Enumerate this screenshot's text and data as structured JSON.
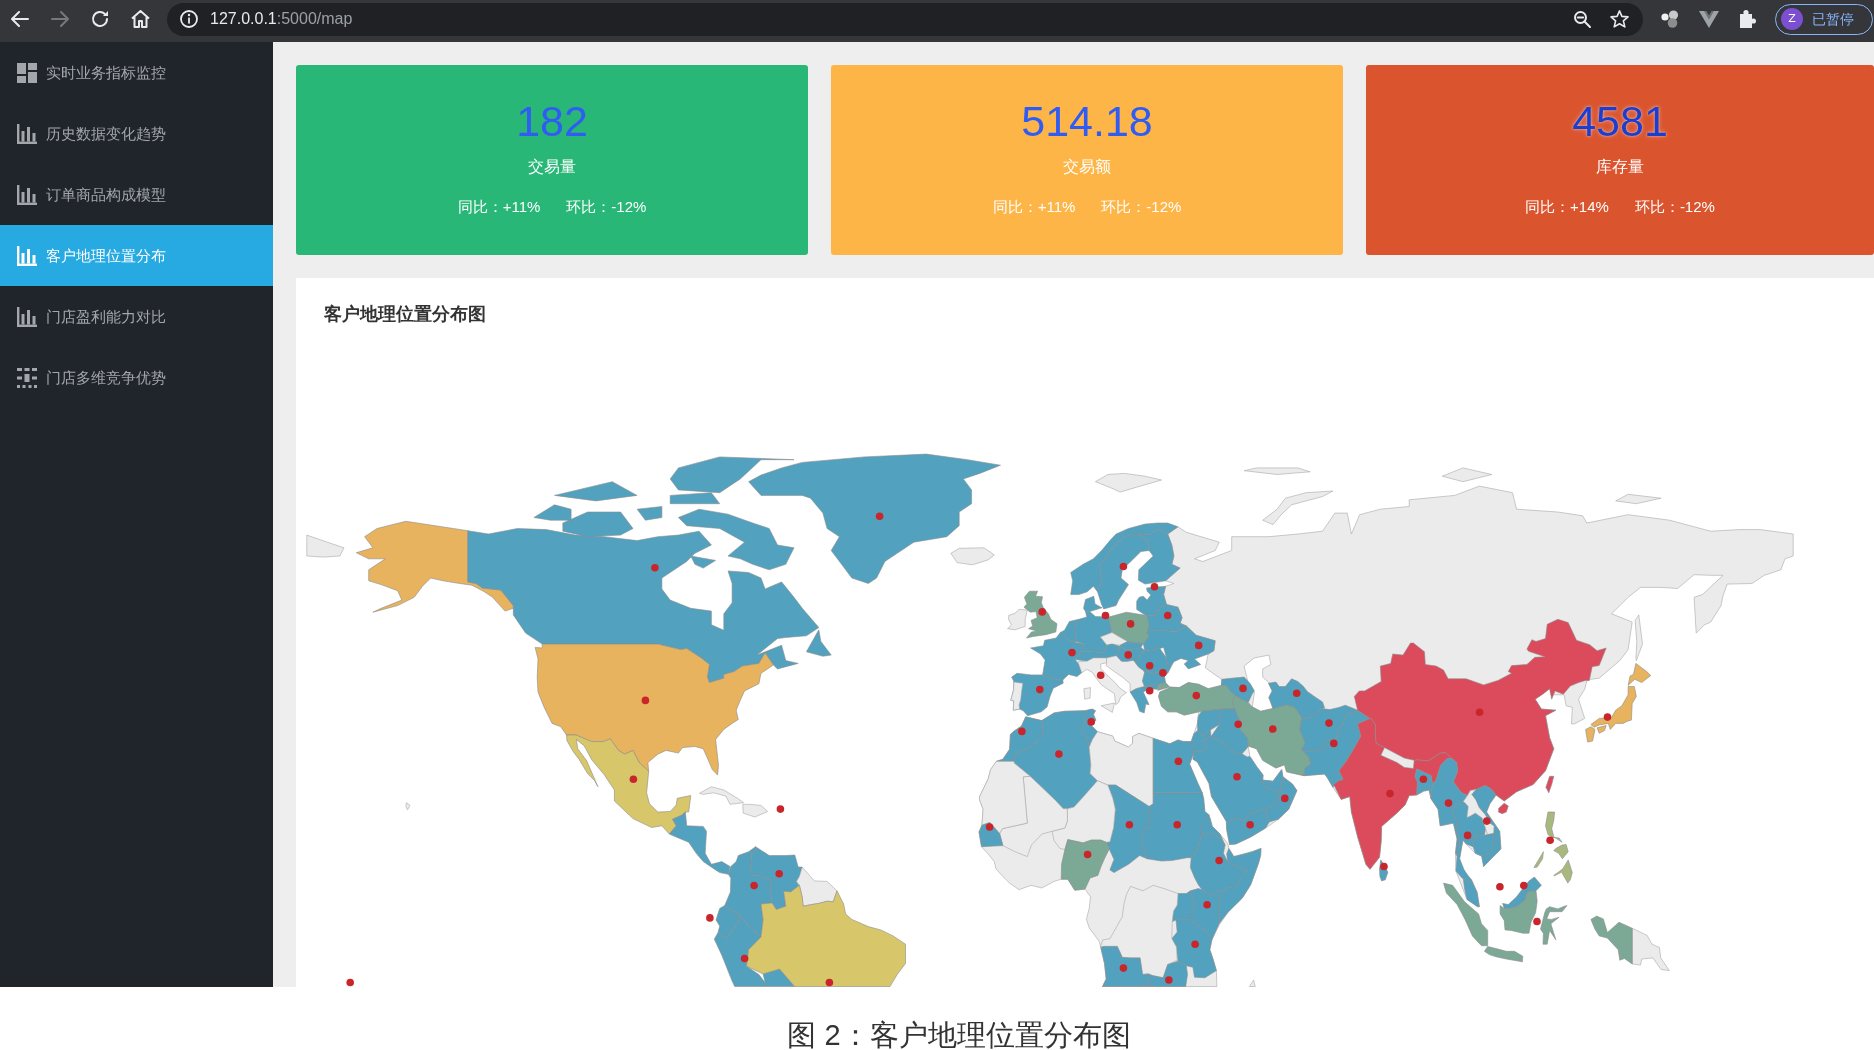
{
  "browser": {
    "back_disabled": false,
    "forward_disabled": true,
    "address": {
      "host": "127.0.0.1",
      "path": ":5000/map"
    },
    "profile": {
      "initial": "Z",
      "status": "已暂停"
    }
  },
  "sidebar": {
    "items": [
      {
        "label": "实时业务指标监控",
        "kind": "dashboard",
        "selected": false
      },
      {
        "label": "历史数据变化趋势",
        "kind": "chart",
        "selected": false
      },
      {
        "label": "订单商品构成模型",
        "kind": "chart",
        "selected": false
      },
      {
        "label": "客户地理位置分布",
        "kind": "chart",
        "selected": true
      },
      {
        "label": "门店盈利能力对比",
        "kind": "chart",
        "selected": false
      },
      {
        "label": "门店多维竞争优势",
        "kind": "grid",
        "selected": false
      }
    ]
  },
  "cards": [
    {
      "value": "182",
      "label": "交易量",
      "yoy": "同比：+11%",
      "mom": "环比：-12%",
      "color": "#29b778"
    },
    {
      "value": "514.18",
      "label": "交易额",
      "yoy": "同比：+11%",
      "mom": "环比：-12%",
      "color": "#feb548"
    },
    {
      "value": "4581",
      "label": "库存量",
      "yoy": "同比：+14%",
      "mom": "环比：-12%",
      "color": "#da542e"
    }
  ],
  "map_panel": {
    "title": "客户地理位置分布图"
  },
  "caption": "图 2：客户地理位置分布图"
}
